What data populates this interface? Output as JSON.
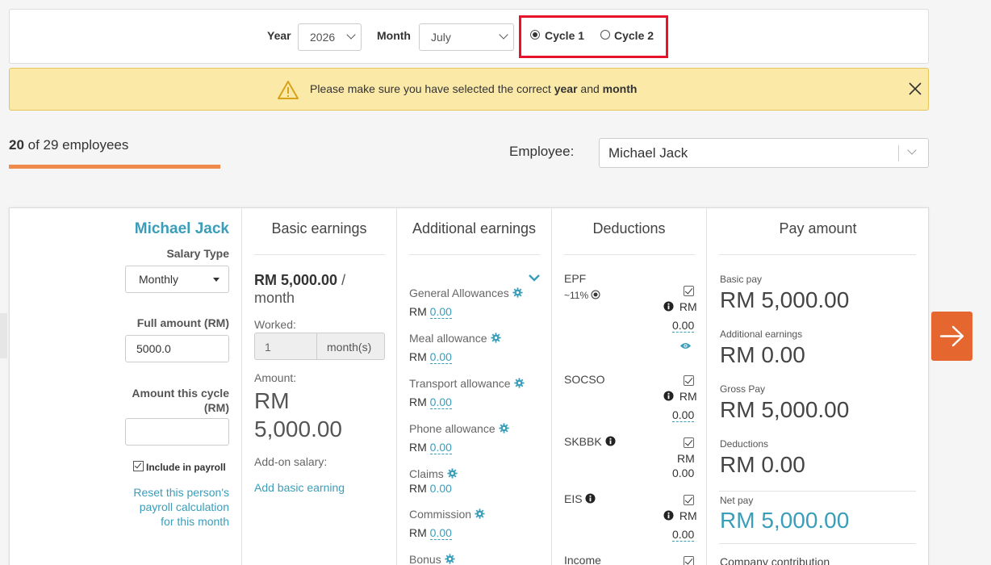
{
  "filters": {
    "year_label": "Year",
    "year_value": "2026",
    "month_label": "Month",
    "month_value": "July",
    "cycle1_label": "Cycle 1",
    "cycle2_label": "Cycle 2",
    "selected_cycle": "Cycle 1"
  },
  "warning": {
    "prefix": "Please make sure you have selected the correct ",
    "year_word": "year",
    "and_word": " and ",
    "month_word": "month"
  },
  "progress": {
    "current": "20",
    "rest": " of 29 employees"
  },
  "employee_select": {
    "label": "Employee:",
    "value": "Michael Jack"
  },
  "profile": {
    "name": "Michael Jack",
    "salary_type_label": "Salary Type",
    "salary_type_value": "Monthly",
    "full_amount_label": "Full amount (RM)",
    "full_amount_value": "5000.0",
    "amount_cycle_label_1": "Amount this cycle",
    "amount_cycle_label_2": "(RM)",
    "amount_cycle_value": "",
    "include_label": "Include in payroll",
    "reset_1": "Reset this person's",
    "reset_2": "payroll calculation",
    "reset_3": "for this month"
  },
  "basic": {
    "title": "Basic earnings",
    "rate": "RM 5,000.00",
    "rate_suffix": " /",
    "rate_unit": "month",
    "worked_label": "Worked:",
    "worked_value": "1",
    "worked_unit": "month(s)",
    "amount_label": "Amount:",
    "amount_1": "RM",
    "amount_2": "5,000.00",
    "addon_label": "Add-on salary:",
    "add_link": "Add basic earning"
  },
  "additional": {
    "title": "Additional earnings",
    "items": [
      {
        "label": "General Allowances",
        "prefix": "RM ",
        "value": "0.00"
      },
      {
        "label": "Meal allowance",
        "prefix": "RM ",
        "value": "0.00"
      },
      {
        "label": "Transport allowance",
        "prefix": "RM ",
        "value": "0.00"
      },
      {
        "label": "Phone allowance",
        "prefix": "RM ",
        "value": "0.00"
      },
      {
        "label": "Claims",
        "prefix": "RM ",
        "value": "0.00"
      },
      {
        "label": "Commission",
        "prefix": "RM ",
        "value": "0.00"
      },
      {
        "label": "Bonus",
        "prefix": "",
        "value": ""
      }
    ]
  },
  "deductions": {
    "title": "Deductions",
    "epf_label": "EPF",
    "epf_rate": "~11%",
    "epf_rm": "RM",
    "epf_value": "0.00",
    "socso_label": "SOCSO",
    "socso_rm": "RM",
    "socso_value": "0.00",
    "skbbk_label": "SKBBK",
    "skbbk_rm": "RM",
    "skbbk_value": "0.00",
    "eis_label": "EIS",
    "eis_rm": "RM",
    "eis_value": "0.00",
    "income_label": "Income"
  },
  "pay": {
    "title": "Pay amount",
    "basic_label": "Basic pay",
    "basic_value": "RM 5,000.00",
    "additional_label": "Additional earnings",
    "additional_value": "RM 0.00",
    "gross_label": "Gross Pay",
    "gross_value": "RM 5,000.00",
    "deductions_label": "Deductions",
    "deductions_value": "RM 0.00",
    "net_label": "Net pay",
    "net_value": "RM 5,000.00",
    "company_label": "Company contribution"
  },
  "colors": {
    "accent": "#3a9dba",
    "orange": "#e5662e",
    "warning_bg": "#fbe9a8",
    "highlight": "#e5142b"
  }
}
